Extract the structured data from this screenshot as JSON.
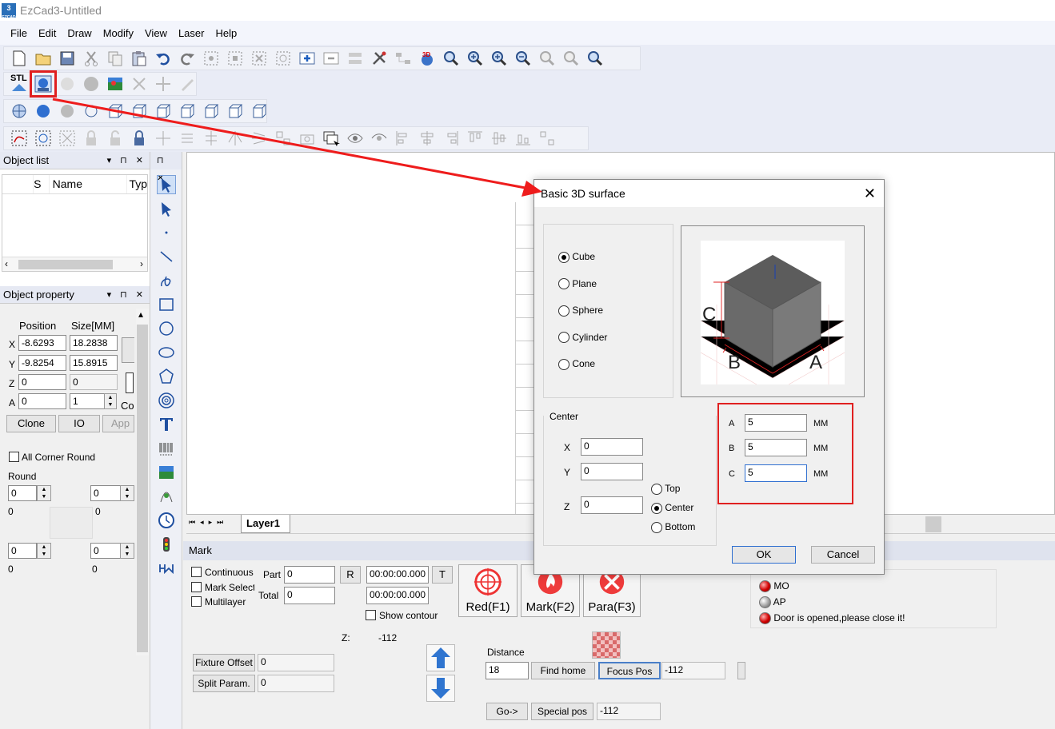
{
  "app": {
    "title": "EzCad3-Untitled",
    "logo_text": "3",
    "logo_sub": "EZCAD"
  },
  "menu": [
    "File",
    "Edit",
    "Draw",
    "Modify",
    "View",
    "Laser",
    "Help"
  ],
  "toolbar": {
    "stl_label": "STL"
  },
  "object_list": {
    "title": "Object list",
    "columns": [
      "S",
      "Name",
      "Typ"
    ]
  },
  "object_property": {
    "title": "Object property",
    "position_label": "Position",
    "size_label": "Size[MM]",
    "rows": [
      {
        "axis": "X",
        "pos": "-8.6293",
        "size": "18.2838"
      },
      {
        "axis": "Y",
        "pos": "-9.8254",
        "size": "15.8915"
      },
      {
        "axis": "Z",
        "pos": "0",
        "size": "0"
      },
      {
        "axis": "A",
        "pos": "0",
        "size": "1"
      }
    ],
    "co_label": "Co",
    "clone_label": "Clone",
    "io_label": "IO",
    "apply_label": "App",
    "corner_round_label": "All Corner Round",
    "round_label": "Round",
    "round_values": [
      "0",
      "0",
      "0",
      "0"
    ],
    "round_sub": [
      "0",
      "0",
      "0",
      "0"
    ]
  },
  "layer": {
    "tab": "Layer1"
  },
  "mark": {
    "title": "Mark",
    "continuous_label": "Continuous",
    "mark_select_label": "Mark Select",
    "multilayer_label": "Multilayer",
    "part_label": "Part",
    "part_value": "0",
    "total_label": "Total",
    "total_value": "0",
    "r_label": "R",
    "t_label": "T",
    "time1": "00:00:00.000",
    "time2": "00:00:00.000",
    "show_contour_label": "Show contour",
    "red_label": "Red(F1)",
    "mark_label": "Mark(F2)",
    "para_label": "Para(F3)",
    "z_label": "Z:",
    "z_value": "-112",
    "distance_label": "Distance",
    "distance_value": "18",
    "find_home_label": "Find home",
    "focus_pos_label": "Focus Pos",
    "focus_pos_value": "-112",
    "goto_label": "Go->",
    "special_pos_label": "Special pos",
    "special_pos_value": "-112",
    "fixture_offset_label": "Fixture Offset",
    "fixture_offset_value": "0",
    "split_param_label": "Split Param.",
    "split_param_value": "0"
  },
  "status": {
    "items": [
      {
        "led": "red",
        "text": "MO"
      },
      {
        "led": "gray",
        "text": "AP"
      },
      {
        "led": "red",
        "text": "Door is opened,please close it!"
      }
    ]
  },
  "dialog": {
    "title": "Basic 3D surface",
    "shapes": [
      {
        "label": "Cube",
        "selected": true
      },
      {
        "label": "Plane",
        "selected": false
      },
      {
        "label": "Sphere",
        "selected": false
      },
      {
        "label": "Cylinder",
        "selected": false
      },
      {
        "label": "Cone",
        "selected": false
      }
    ],
    "preview_labels": {
      "a": "A",
      "b": "B",
      "c": "C"
    },
    "center_label": "Center",
    "center": [
      {
        "axis": "X",
        "value": "0"
      },
      {
        "axis": "Y",
        "value": "0"
      },
      {
        "axis": "Z",
        "value": "0"
      }
    ],
    "vertical": [
      {
        "label": "Top",
        "selected": false
      },
      {
        "label": "Center",
        "selected": true
      },
      {
        "label": "Bottom",
        "selected": false
      }
    ],
    "dims": [
      {
        "axis": "A",
        "value": "5",
        "unit": "MM"
      },
      {
        "axis": "B",
        "value": "5",
        "unit": "MM"
      },
      {
        "axis": "C",
        "value": "5",
        "unit": "MM"
      }
    ],
    "ok_label": "OK",
    "cancel_label": "Cancel"
  },
  "colors": {
    "highlight": "#e02020",
    "arrow": "#ee1c1c",
    "accent": "#1e6fd9"
  }
}
